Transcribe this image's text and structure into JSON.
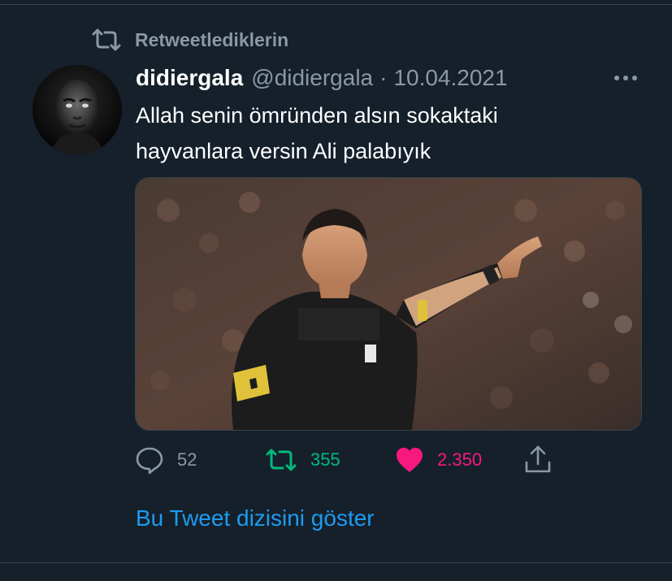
{
  "context": {
    "retweet_label": "Retweetlediklerin"
  },
  "tweet": {
    "display_name": "didiergala",
    "handle": "@didiergala",
    "separator": "·",
    "date": "10.04.2021",
    "text_line1": "Allah senin ömründen alsın sokaktaki",
    "text_line2": "hayvanlara versin Ali palabıyık",
    "media_alt": "referee in black kit pointing"
  },
  "actions": {
    "replies": "52",
    "retweets": "355",
    "likes": "2.350"
  },
  "footer": {
    "show_thread": "Bu Tweet dizisini göster"
  },
  "colors": {
    "background": "#15202b",
    "text_primary": "#ffffff",
    "text_secondary": "#8b98a5",
    "retweet_green": "#00ba7c",
    "like_pink": "#f91880",
    "link_blue": "#1d9bf0"
  },
  "icons": {
    "context": "retweet-icon",
    "more": "more-icon",
    "reply": "reply-icon",
    "retweet": "retweet-icon",
    "like": "heart-icon",
    "share": "share-icon"
  }
}
